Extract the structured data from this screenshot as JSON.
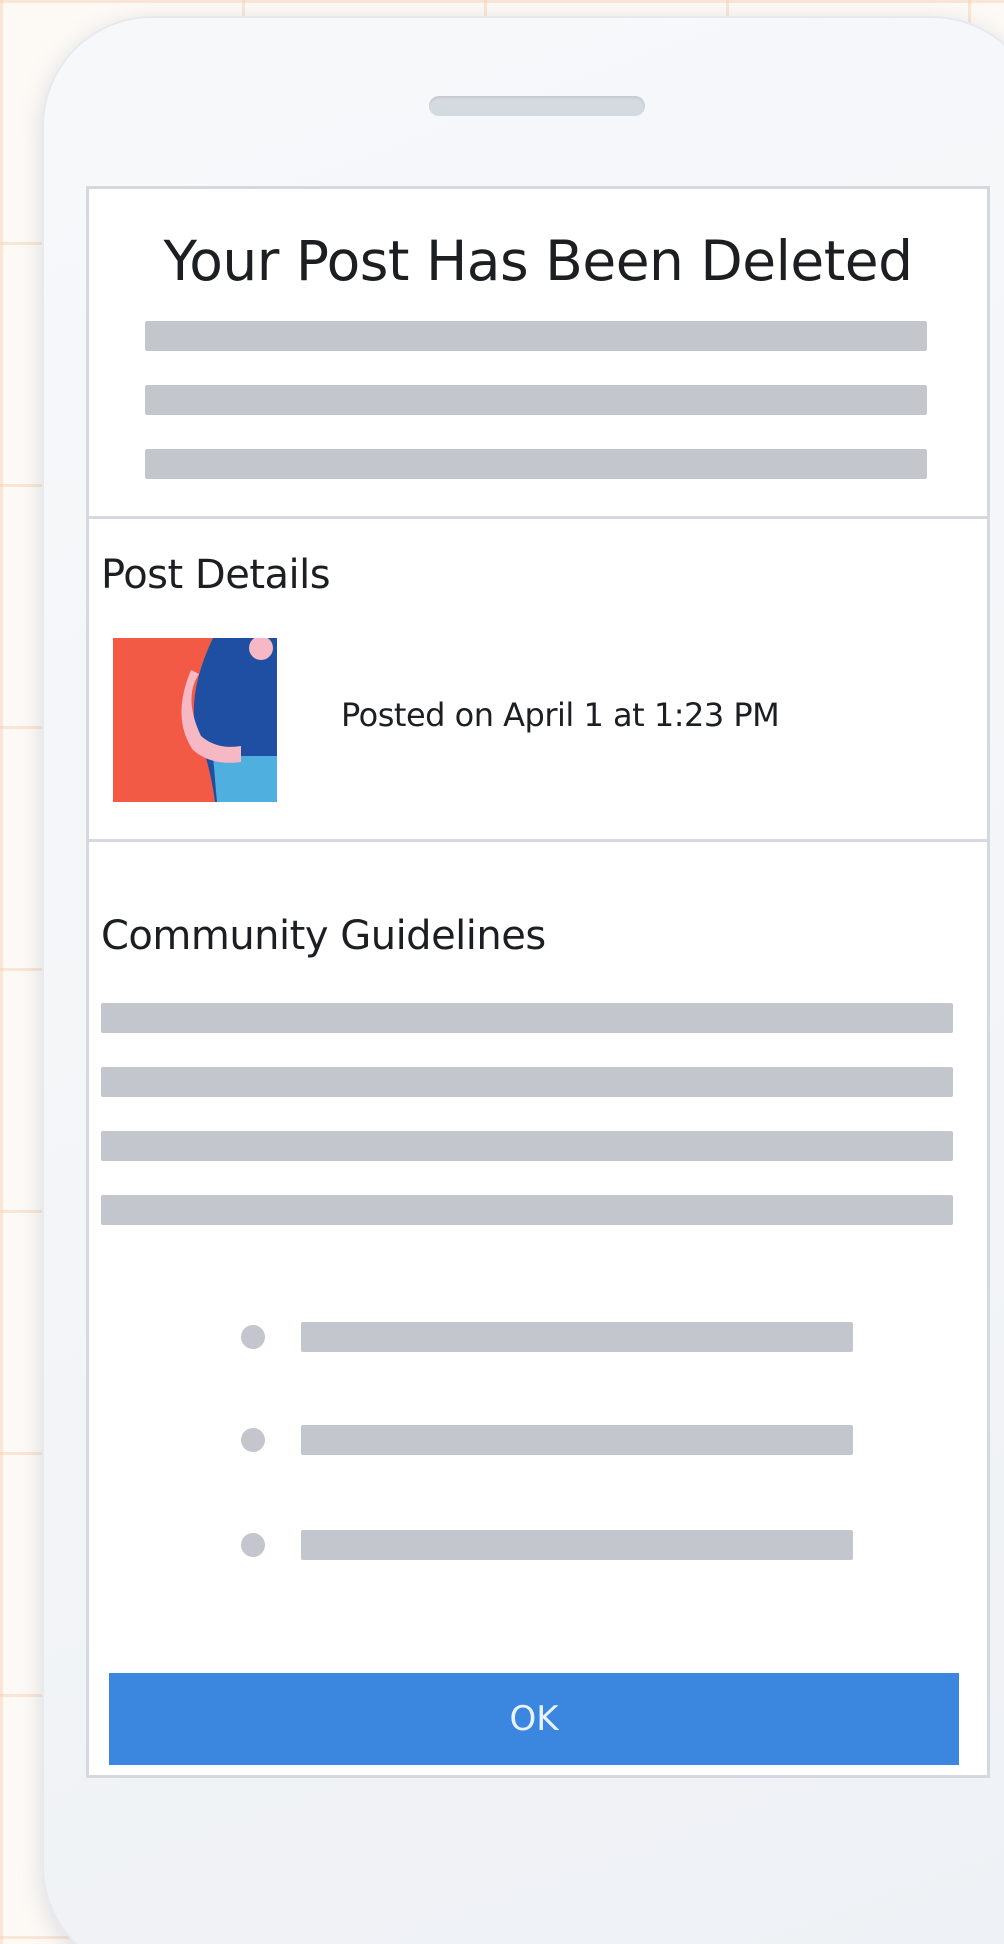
{
  "header": {
    "title": "Your Post Has Been Deleted"
  },
  "post_details": {
    "heading": "Post Details",
    "posted_text": "Posted on April 1 at 1:23 PM"
  },
  "community_guidelines": {
    "heading": "Community Guidelines"
  },
  "actions": {
    "ok_label": "OK"
  },
  "colors": {
    "primary_button": "#3b87e0",
    "placeholder_bar": "#c3c6cd",
    "thumbnail_bg": "#f35a46",
    "divider": "#d5d8de"
  }
}
